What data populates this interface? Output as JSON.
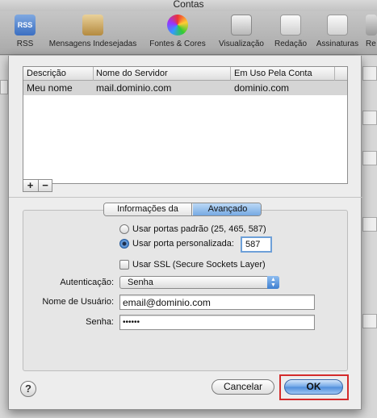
{
  "window": {
    "title": "Contas"
  },
  "toolbar": {
    "items": [
      {
        "label": "RSS",
        "icon": "rss-icon",
        "badge": "RSS"
      },
      {
        "label": "Mensagens Indesejadas",
        "icon": "junk-mail-icon"
      },
      {
        "label": "Fontes & Cores",
        "icon": "fonts-colors-icon"
      },
      {
        "label": "Visualização",
        "icon": "viewing-icon"
      },
      {
        "label": "Redação",
        "icon": "composing-icon"
      },
      {
        "label": "Assinaturas",
        "icon": "signatures-icon"
      },
      {
        "label": "Re",
        "icon": "rules-icon"
      }
    ]
  },
  "accounts_table": {
    "headers": [
      "Descrição",
      "Nome do Servidor",
      "Em Uso Pela Conta"
    ],
    "rows": [
      {
        "description": "Meu nome",
        "server": "mail.dominio.com",
        "account": "dominio.com"
      }
    ]
  },
  "table_buttons": {
    "add": "+",
    "remove": "−"
  },
  "tabs": {
    "info": "Informações da Conta",
    "advanced": "Avançado",
    "selected": "Avançado"
  },
  "port": {
    "default_label": "Usar portas padrão (25, 465, 587)",
    "custom_label": "Usar porta personalizada:",
    "custom_selected": true,
    "value": "587"
  },
  "ssl": {
    "label": "Usar SSL (Secure Sockets Layer)",
    "checked": false
  },
  "auth": {
    "label": "Autenticação:",
    "value": "Senha"
  },
  "username": {
    "label": "Nome de Usuário:",
    "value": "email@dominio.com"
  },
  "password": {
    "label": "Senha:",
    "value": "••••••"
  },
  "footer": {
    "help": "?",
    "cancel": "Cancelar",
    "ok": "OK"
  },
  "colors": {
    "accent": "#4f8edb",
    "highlight": "#d42b2b"
  }
}
